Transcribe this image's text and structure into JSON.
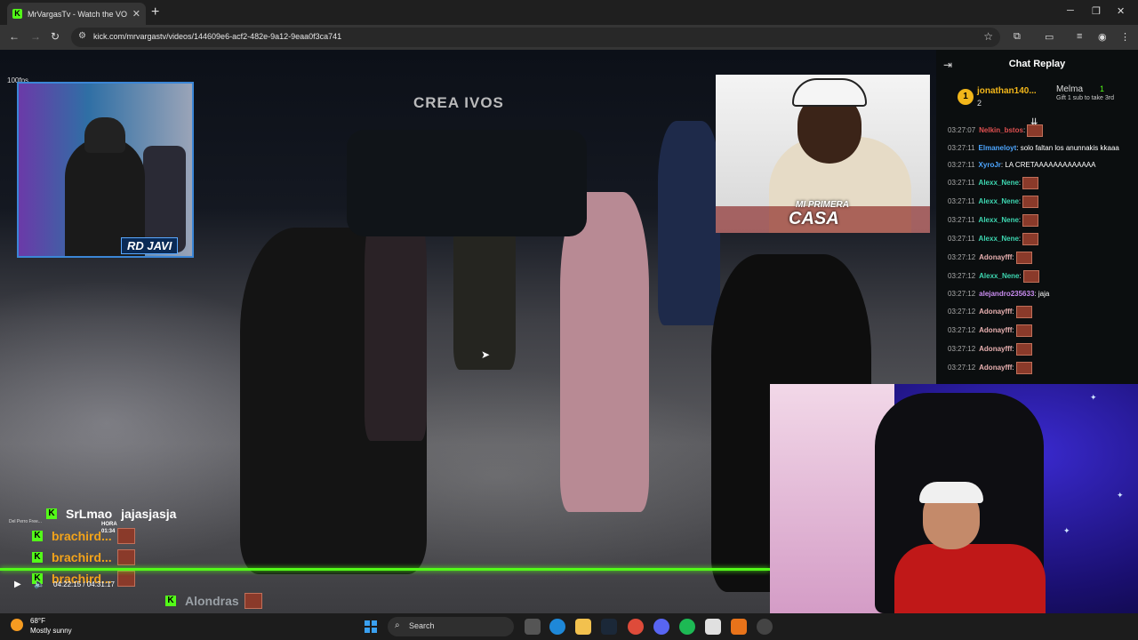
{
  "browser": {
    "tab_title": "MrVargasTv - Watch the VO",
    "tab_favicon": "K",
    "url": "kick.com/mrvargastv/videos/144609e6-acf2-482e-9a12-9eaa0f3ca741"
  },
  "video": {
    "fps_counter": "100fps",
    "watermark": "CREA IVOS",
    "streamer_cam_name": "RD JAVI",
    "guest_cam_logo_top": "MI PRIMERA",
    "guest_cam_logo": "CASA",
    "timecode": "04:22:15 / 04:31:17",
    "mini_label": "Del Perro Free...",
    "hora_label": "HORA",
    "hora_time": "01:34",
    "overlay_chat": [
      {
        "user": "SrLmao",
        "text": "jajasjasja",
        "color": "#ffffff"
      },
      {
        "user": "brachird...",
        "text": "",
        "color": "#f2a31a"
      },
      {
        "user": "brachird...",
        "text": "",
        "color": "#f2a31a"
      },
      {
        "user": "brachird...",
        "text": "",
        "color": "#f2a31a"
      },
      {
        "user": "Alondras",
        "text": "",
        "color": "#9aa0a6"
      }
    ],
    "progress_fraction": 0.967
  },
  "chat": {
    "title": "Chat Replay",
    "leaderboard": {
      "first_user": "jonathan140...",
      "first_count": "2",
      "second_user": "Melma",
      "second_count": "1",
      "gift_text": "Gift 1 sub to take 3rd"
    },
    "messages": [
      {
        "ts": "03:27:07",
        "user": "Nelkin_bstos",
        "text": "",
        "color": "#e05050",
        "emote": true
      },
      {
        "ts": "03:27:11",
        "user": "Elmaneloyt",
        "text": "solo faltan los anunnakis kkaaa",
        "color": "#4da6ff",
        "emote": false
      },
      {
        "ts": "03:27:11",
        "user": "XyroJr",
        "text": "LA CRETAAAAAAAAAAAAA",
        "color": "#4da6ff",
        "emote": false
      },
      {
        "ts": "03:27:11",
        "user": "Alexx_Nene",
        "text": "",
        "color": "#3dd6b0",
        "emote": true
      },
      {
        "ts": "03:27:11",
        "user": "Alexx_Nene",
        "text": "",
        "color": "#3dd6b0",
        "emote": true
      },
      {
        "ts": "03:27:11",
        "user": "Alexx_Nene",
        "text": "",
        "color": "#3dd6b0",
        "emote": true
      },
      {
        "ts": "03:27:11",
        "user": "Alexx_Nene",
        "text": "",
        "color": "#3dd6b0",
        "emote": true
      },
      {
        "ts": "03:27:12",
        "user": "Adonayfff",
        "text": "",
        "color": "#e8b0b0",
        "emote": true
      },
      {
        "ts": "03:27:12",
        "user": "Alexx_Nene",
        "text": "",
        "color": "#3dd6b0",
        "emote": true
      },
      {
        "ts": "03:27:12",
        "user": "alejandro235633",
        "text": "jaja",
        "color": "#c98cf0",
        "emote": false
      },
      {
        "ts": "03:27:12",
        "user": "Adonayfff",
        "text": "",
        "color": "#e8b0b0",
        "emote": true
      },
      {
        "ts": "03:27:12",
        "user": "Adonayfff",
        "text": "",
        "color": "#e8b0b0",
        "emote": true
      },
      {
        "ts": "03:27:12",
        "user": "Adonayfff",
        "text": "",
        "color": "#e8b0b0",
        "emote": true
      },
      {
        "ts": "03:27:12",
        "user": "Adonayfff",
        "text": "",
        "color": "#e8b0b0",
        "emote": true
      }
    ]
  },
  "taskbar": {
    "temp": "68°F",
    "condition": "Mostly sunny",
    "search_placeholder": "Search"
  },
  "colors": {
    "kick_green": "#53fc18",
    "chat_bg": "#0b0e0f",
    "tab_bg": "#1f1f1f"
  }
}
